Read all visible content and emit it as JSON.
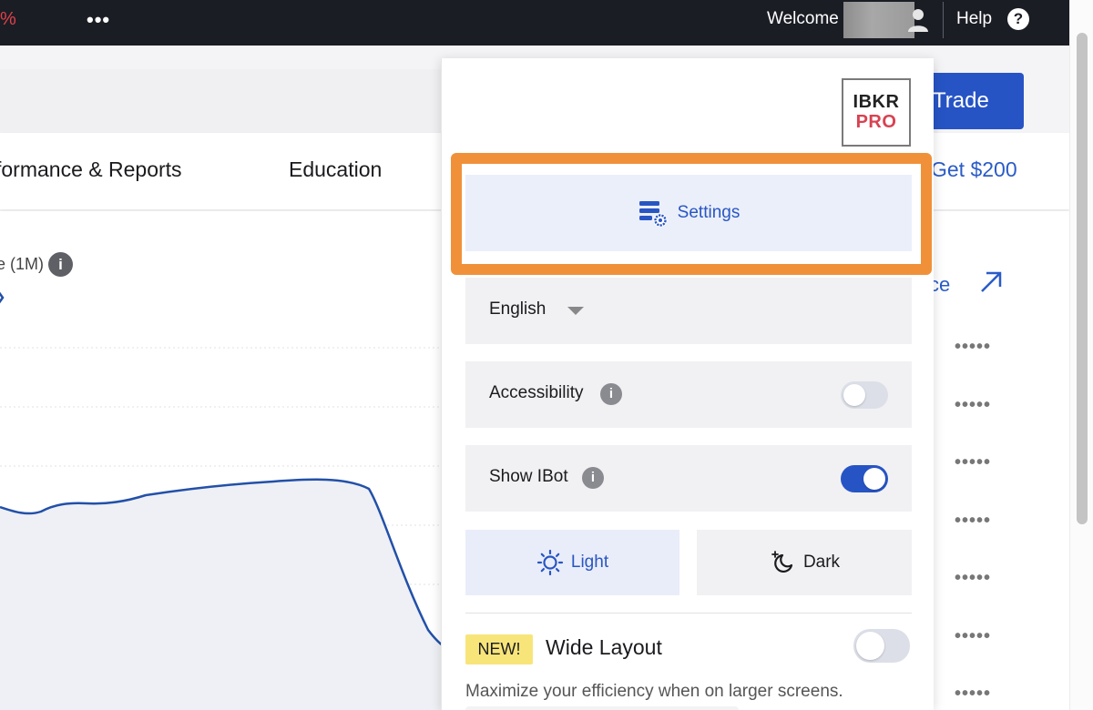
{
  "topbar": {
    "percent_fragment": "%",
    "more_label": "•••",
    "welcome_label": "Welcome",
    "help_label": "Help",
    "help_icon": "?"
  },
  "nav": {
    "performance_reports": "formance & Reports",
    "education": "Education",
    "promo": "Get $200"
  },
  "trade_button": "Trade",
  "chart": {
    "label": "e (1M)",
    "info_icon": "i",
    "line_color": "#2350a8"
  },
  "right_column": {
    "link_fragment": "ce",
    "dots": [
      "•••••",
      "•••••",
      "•••••",
      "•••••",
      "•••••",
      "•••••",
      "•••••"
    ]
  },
  "panel": {
    "logo_top": "IBKR",
    "logo_bottom": "PRO",
    "settings_label": "Settings",
    "language_value": "English",
    "accessibility_label": "Accessibility",
    "accessibility_on": false,
    "show_ibot_label": "Show IBot",
    "show_ibot_on": true,
    "info_icon": "i",
    "theme_light_label": "Light",
    "theme_dark_label": "Dark",
    "selected_theme": "Light",
    "new_badge": "NEW!",
    "wide_layout_label": "Wide Layout",
    "wide_layout_on": false,
    "wide_layout_desc": "Maximize your efficiency when on larger screens."
  },
  "colors": {
    "accent": "#2754c5",
    "highlight": "#f0913a",
    "topbar": "#1b1d25"
  }
}
